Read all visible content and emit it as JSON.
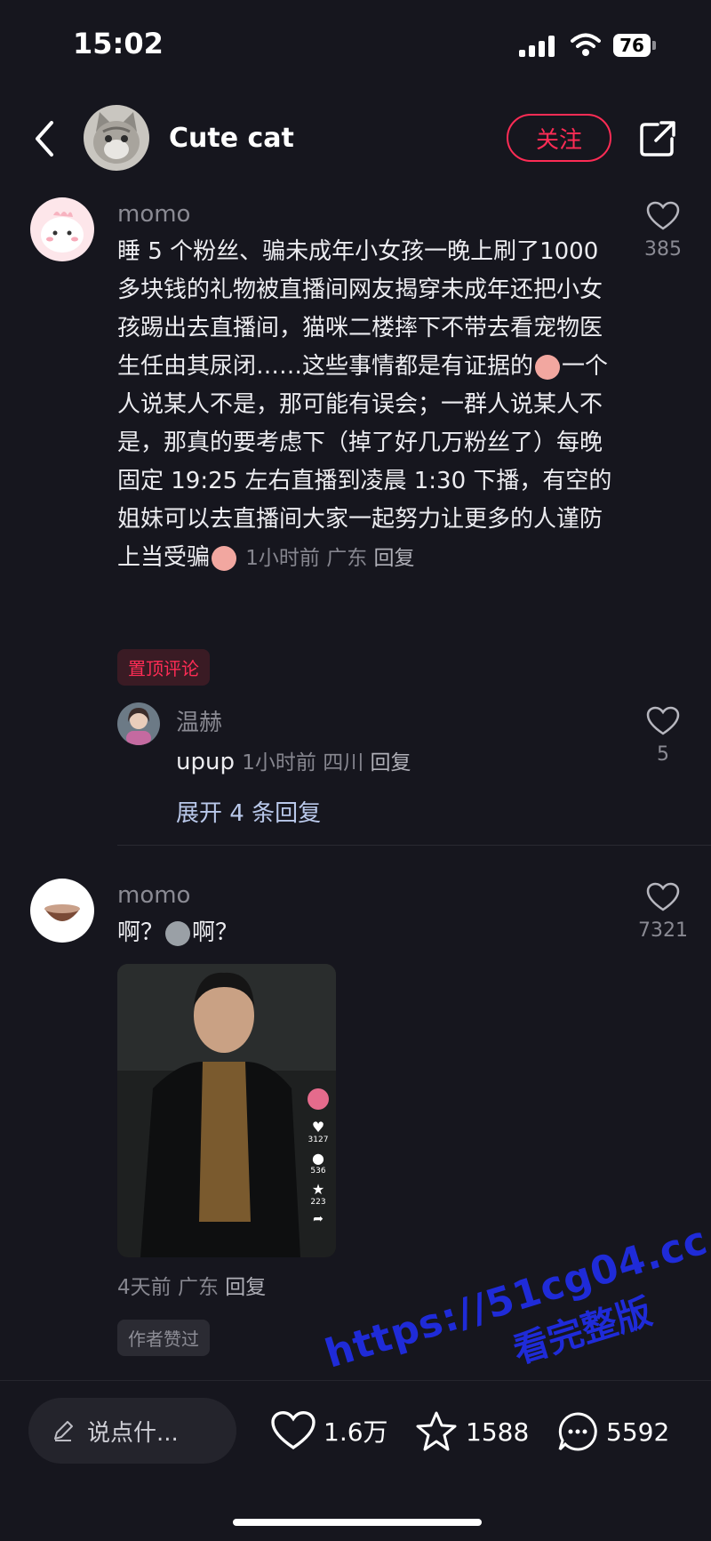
{
  "status": {
    "time": "15:02",
    "battery": "76"
  },
  "header": {
    "title": "Cute cat",
    "follow_label": "关注"
  },
  "comments": [
    {
      "user": "momo",
      "text_part1": "睡 5 个粉丝、骗未成年小女孩一晚上刷了1000 多块钱的礼物被直播间网友揭穿未成年还把小女孩踢出去直播间，猫咪二楼摔下不带去看宠物医生任由其尿闭……这些事情都是有证据的",
      "text_part2": "一个人说某人不是，那可能有误会；一群人说某人不是，那真的要考虑下（掉了好几万粉丝了）每晚固定 19:25 左右直播到凌晨 1:30 下播，有空的姐妹可以去直播间大家一起努力让更多的人谨防上当受骗",
      "time": "1小时前",
      "location": "广东",
      "reply_label": "回复",
      "likes": "385",
      "badge": "置顶评论",
      "reply": {
        "user": "温赫",
        "text": "upup",
        "time": "1小时前",
        "location": "四川",
        "reply_label": "回复",
        "likes": "5"
      },
      "expand_label": "展开 4 条回复"
    },
    {
      "user": "momo",
      "text_a": "啊？",
      "text_b": "啊？",
      "likes": "7321",
      "video_stats": {
        "likes": "3127",
        "comments": "536",
        "favorites": "223"
      },
      "time": "4天前",
      "location": "广东",
      "reply_label": "回复",
      "badge": "作者赞过"
    }
  ],
  "bottom_bar": {
    "input_placeholder": "说点什...",
    "like_count": "1.6万",
    "favorite_count": "1588",
    "comment_count": "5592"
  },
  "watermark": {
    "line1": "https://51cg04.cc",
    "line2": "看完整版"
  },
  "colors": {
    "background": "#16161e",
    "accent": "#fe2c55",
    "expand_link": "#b9c8ea"
  }
}
